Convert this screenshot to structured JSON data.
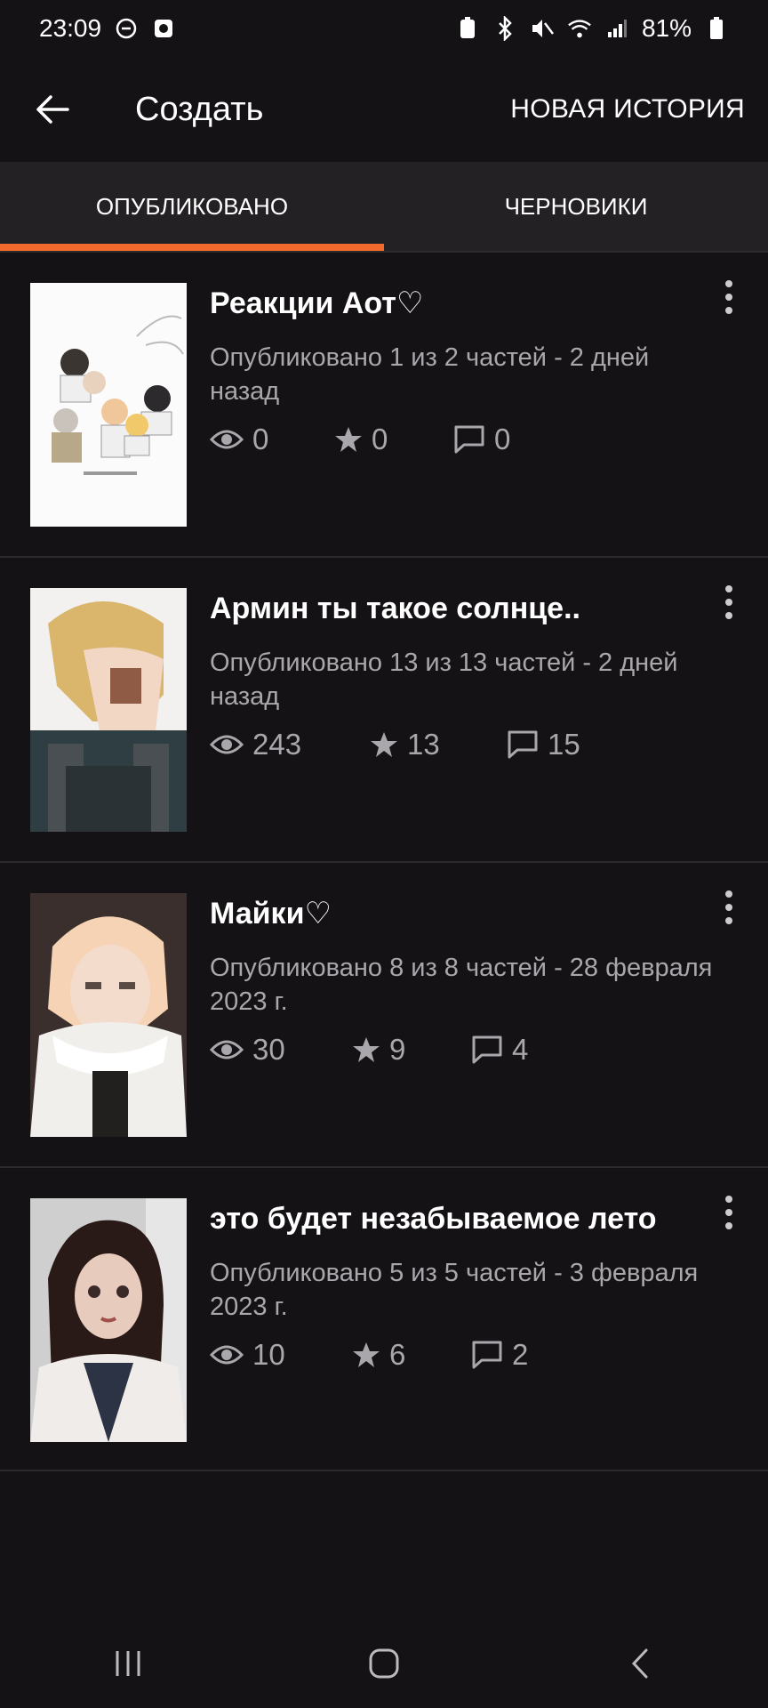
{
  "status": {
    "time": "23:09",
    "battery": "81%"
  },
  "appbar": {
    "title": "Создать",
    "new_story": "НОВАЯ ИСТОРИЯ"
  },
  "tabs": [
    {
      "label": "ОПУБЛИКОВАНО",
      "active": true
    },
    {
      "label": "ЧЕРНОВИКИ",
      "active": false
    }
  ],
  "accent": "#f26b2d",
  "stories": [
    {
      "title": "Реакции Аот♡",
      "meta": "Опубликовано 1 из 2 частей - 2 дней назад",
      "views": "0",
      "votes": "0",
      "comments": "0"
    },
    {
      "title": "Армин ты такое солнце..",
      "meta": "Опубликовано 13 из 13 частей - 2 дней назад",
      "views": "243",
      "votes": "13",
      "comments": "15"
    },
    {
      "title": "Майки♡",
      "meta": "Опубликовано 8 из 8 частей - 28 февраля 2023 г.",
      "views": "30",
      "votes": "9",
      "comments": "4"
    },
    {
      "title": "это будет незабываемое лето",
      "meta": "Опубликовано 5 из 5 частей - 3 февраля 2023 г.",
      "views": "10",
      "votes": "6",
      "comments": "2"
    }
  ]
}
